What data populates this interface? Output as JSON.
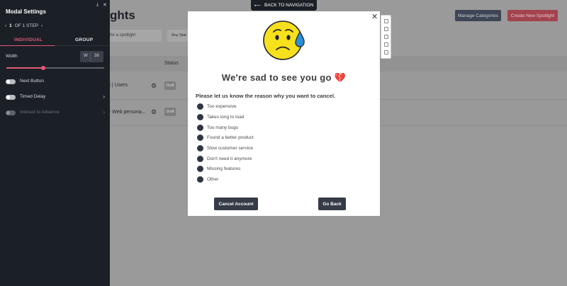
{
  "app": {
    "title": "ghts",
    "manage_categories": "Manage Categories",
    "create_new_spotlight": "Create New Spotlight",
    "search_placeholder": "for a spotlight",
    "filter_status": "Any Stat",
    "col_status": "Status",
    "rows": [
      {
        "name": "t | Users",
        "badge": "Draft"
      },
      {
        "name": "- Web persona...",
        "badge": "Draft"
      }
    ]
  },
  "sidebar": {
    "title": "Modal Settings",
    "step_number": "1",
    "step_text": "OF 1 STEP",
    "tabs": [
      "INDIVIDUAL",
      "GROUP"
    ],
    "width_label": "Width",
    "width_unit": "W",
    "width_value": "38",
    "width_slider_fraction": 0.38,
    "toggles": [
      {
        "label": "Next Button",
        "enabled": true,
        "has_chevron": false
      },
      {
        "label": "Timed Delay",
        "enabled": true,
        "has_chevron": true
      },
      {
        "label": "Interact to Advance",
        "enabled": false,
        "has_chevron": true
      }
    ]
  },
  "back_nav": {
    "label": "BACK TO NAVIGATION",
    "icon": "arrow-left-icon"
  },
  "modal": {
    "title": "We're sad to see you go",
    "title_emoji": "💔",
    "question": "Please let us know the reason why you want to cancel.",
    "options": [
      "Too expensive",
      "Takes long to load",
      "Too many bugs",
      "Found a better product",
      "Slow customer service",
      "Don't need it anymore",
      "Missing features",
      "Other"
    ],
    "cancel_button": "Cancel Account",
    "go_back_button": "Go Back"
  },
  "colors": {
    "accent_pink": "#e15a78",
    "sidebar_bg": "#1b1f26",
    "modal_button": "#353b47",
    "create_button": "#a2434d"
  }
}
